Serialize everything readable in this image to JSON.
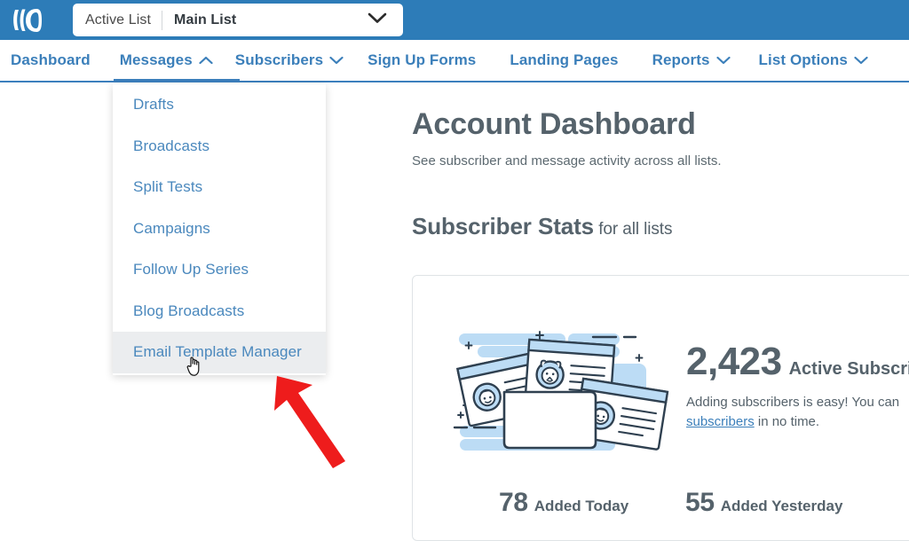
{
  "topbar": {
    "logo_icon": "aweber-logo-icon",
    "list_selector": {
      "label": "Active List",
      "value": "Main List",
      "caret_icon": "chevron-down-icon"
    }
  },
  "nav": {
    "items": [
      {
        "label": "Dashboard",
        "caret": "",
        "active": false
      },
      {
        "label": "Messages",
        "caret": "⌃",
        "active": true
      },
      {
        "label": "Subscribers",
        "caret": "⌄",
        "active": false
      },
      {
        "label": "Sign Up Forms",
        "caret": "",
        "active": false
      },
      {
        "label": "Landing Pages",
        "caret": "",
        "active": false
      },
      {
        "label": "Reports",
        "caret": "⌄",
        "active": false
      },
      {
        "label": "List Options",
        "caret": "⌄",
        "active": false
      }
    ]
  },
  "dropdown": {
    "parent": "Messages",
    "items": [
      {
        "label": "Drafts",
        "hovered": false
      },
      {
        "label": "Broadcasts",
        "hovered": false
      },
      {
        "label": "Split Tests",
        "hovered": false
      },
      {
        "label": "Campaigns",
        "hovered": false
      },
      {
        "label": "Follow Up Series",
        "hovered": false
      },
      {
        "label": "Blog Broadcasts",
        "hovered": false
      },
      {
        "label": "Email Template Manager",
        "hovered": true
      }
    ],
    "cursor_icon": "pointer-hand-cursor-icon"
  },
  "main": {
    "title": "Account Dashboard",
    "subtitle": "See subscriber and message activity across all lists.",
    "section_strong": "Subscriber Stats",
    "section_light": " for all lists"
  },
  "stats": {
    "illustration_icon": "subscriber-cards-illustration",
    "active_subscribers": {
      "value": "2,423",
      "label": "Active Subscribers"
    },
    "description": {
      "line1": "Adding subscribers is easy! You can",
      "link": "subscribers",
      "line2_tail": " in no time."
    },
    "added_today": {
      "value": "78",
      "label": "Added Today"
    },
    "added_yesterday": {
      "value": "55",
      "label": "Added Yesterday"
    }
  },
  "annotation": {
    "arrow_icon": "red-arrow-annotation-icon",
    "color": "#ee1c1c"
  },
  "colors": {
    "header_blue": "#2d7cb8",
    "link_blue": "#3b7fba",
    "menu_link_blue": "#4a88bd",
    "text_slate": "#55626b",
    "hover_gray": "#ebedef",
    "card_border": "#dfe3e6",
    "illustration_blue": "#bcdcf5",
    "illustration_ink": "#2f4050"
  }
}
